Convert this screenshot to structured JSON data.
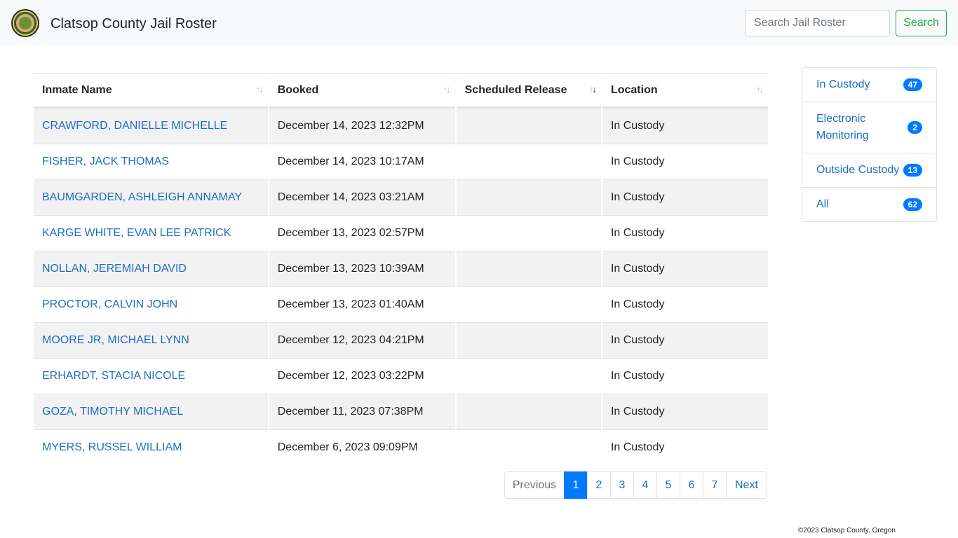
{
  "header": {
    "title": "Clatsop County Jail Roster",
    "search_placeholder": "Search Jail Roster",
    "search_button": "Search"
  },
  "table": {
    "columns": [
      "Inmate Name",
      "Booked",
      "Scheduled Release",
      "Location"
    ],
    "rows": [
      {
        "name": "CRAWFORD, DANIELLE MICHELLE",
        "booked": "December 14, 2023 12:32PM",
        "release": "",
        "location": "In Custody"
      },
      {
        "name": "FISHER, JACK THOMAS",
        "booked": "December 14, 2023 10:17AM",
        "release": "",
        "location": "In Custody"
      },
      {
        "name": "BAUMGARDEN, ASHLEIGH ANNAMAY",
        "booked": "December 14, 2023 03:21AM",
        "release": "",
        "location": "In Custody"
      },
      {
        "name": "KARGE WHITE, EVAN LEE PATRICK",
        "booked": "December 13, 2023 02:57PM",
        "release": "",
        "location": "In Custody"
      },
      {
        "name": "NOLLAN, JEREMIAH DAVID",
        "booked": "December 13, 2023 10:39AM",
        "release": "",
        "location": "In Custody"
      },
      {
        "name": "PROCTOR, CALVIN JOHN",
        "booked": "December 13, 2023 01:40AM",
        "release": "",
        "location": "In Custody"
      },
      {
        "name": "MOORE JR, MICHAEL LYNN",
        "booked": "December 12, 2023 04:21PM",
        "release": "",
        "location": "In Custody"
      },
      {
        "name": "ERHARDT, STACIA NICOLE",
        "booked": "December 12, 2023 03:22PM",
        "release": "",
        "location": "In Custody"
      },
      {
        "name": "GOZA, TIMOTHY MICHAEL",
        "booked": "December 11, 2023 07:38PM",
        "release": "",
        "location": "In Custody"
      },
      {
        "name": "MYERS, RUSSEL WILLIAM",
        "booked": "December 6, 2023 09:09PM",
        "release": "",
        "location": "In Custody"
      }
    ]
  },
  "pagination": {
    "previous": "Previous",
    "pages": [
      "1",
      "2",
      "3",
      "4",
      "5",
      "6",
      "7"
    ],
    "next": "Next"
  },
  "sidebar": {
    "items": [
      {
        "label": "In Custody",
        "count": "47"
      },
      {
        "label": "Electronic Monitoring",
        "count": "2"
      },
      {
        "label": "Outside Custody",
        "count": "13"
      },
      {
        "label": "All",
        "count": "62"
      }
    ]
  },
  "footer": {
    "text": "©2023 Clatsop County, Oregon"
  },
  "colors": {
    "link": "#1b6ec2",
    "active_page": "#007bff",
    "search_button": "#28a745",
    "badge": "#007bff"
  }
}
